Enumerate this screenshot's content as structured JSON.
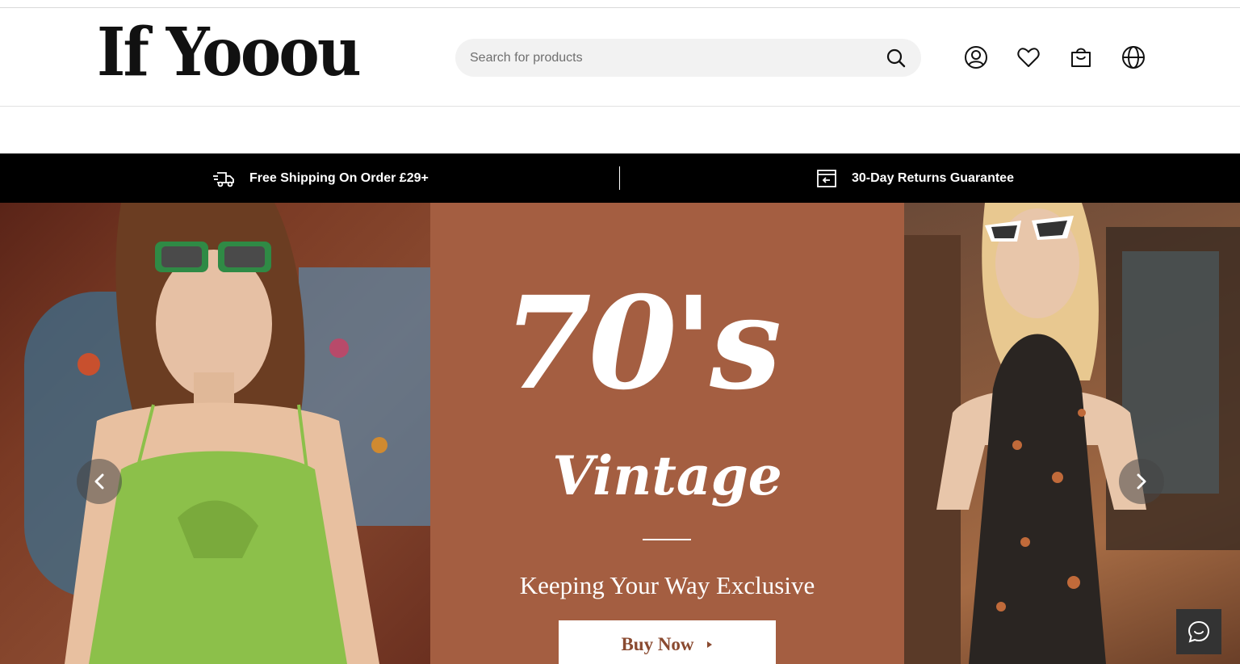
{
  "header": {
    "logo_text": "If Yooou",
    "search": {
      "placeholder": "Search for products"
    },
    "icons": [
      "account-icon",
      "wishlist-heart-icon",
      "shopping-bag-icon",
      "language-globe-icon"
    ]
  },
  "banner": {
    "shipping_text": "Free Shipping On Order £29+",
    "returns_text": "30-Day Returns Guarantee"
  },
  "hero": {
    "headline": "70's",
    "subheadline": "Vintage",
    "tagline": "Keeping Your Way Exclusive",
    "cta_label": "Buy Now",
    "colors": {
      "center_panel": "#a45e41",
      "cta_text": "#8a4a30",
      "left_dress": "#8cc04a",
      "right_dress": "#2a2522"
    }
  },
  "chat": {
    "icon": "chat-bubble-icon"
  }
}
